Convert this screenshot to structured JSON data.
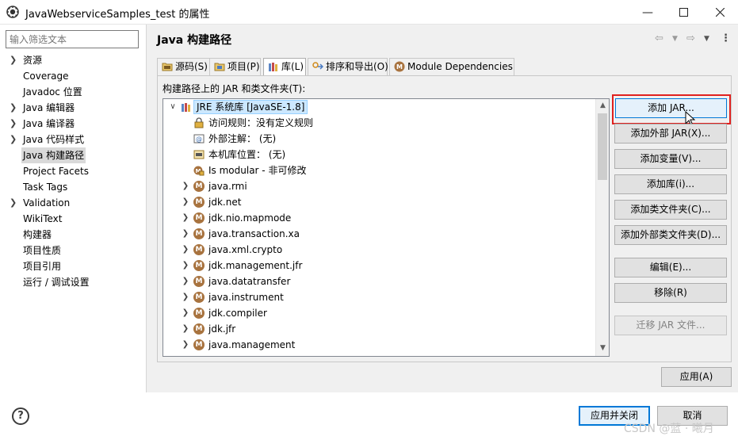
{
  "window": {
    "title": "JavaWebserviceSamples_test 的属性",
    "minimize_icon": "minimize-icon",
    "maximize_icon": "maximize-icon",
    "close_icon": "close-icon"
  },
  "filter": {
    "placeholder": "输入筛选文本"
  },
  "sidebar": {
    "items": [
      {
        "label": "资源",
        "expandable": true
      },
      {
        "label": "Coverage",
        "expandable": false
      },
      {
        "label": "Javadoc 位置",
        "expandable": false
      },
      {
        "label": "Java 编辑器",
        "expandable": true
      },
      {
        "label": "Java 编译器",
        "expandable": true
      },
      {
        "label": "Java 代码样式",
        "expandable": true
      },
      {
        "label": "Java 构建路径",
        "expandable": false,
        "selected": true
      },
      {
        "label": "Project Facets",
        "expandable": false
      },
      {
        "label": "Task Tags",
        "expandable": false
      },
      {
        "label": "Validation",
        "expandable": true
      },
      {
        "label": "WikiText",
        "expandable": false
      },
      {
        "label": "构建器",
        "expandable": false
      },
      {
        "label": "项目性质",
        "expandable": false
      },
      {
        "label": "项目引用",
        "expandable": false
      },
      {
        "label": "运行 / 调试设置",
        "expandable": false
      }
    ]
  },
  "page": {
    "title": "Java 构建路径",
    "tabs": [
      {
        "label": "源码(S)",
        "icon": "source-folder-icon"
      },
      {
        "label": "项目(P)",
        "icon": "project-icon"
      },
      {
        "label": "库(L)",
        "icon": "library-icon",
        "active": true
      },
      {
        "label": "排序和导出(O)",
        "icon": "order-export-icon"
      },
      {
        "label": "Module Dependencies",
        "icon": "module-icon"
      }
    ],
    "section_label": "构建路径上的 JAR 和类文件夹(T):"
  },
  "tree": {
    "root": "JRE 系统库 [JavaSE-1.8]",
    "children": [
      {
        "label": "访问规则：没有定义规则",
        "icon": "access-rules-icon"
      },
      {
        "label": "外部注解：  (无)",
        "icon": "annotation-icon"
      },
      {
        "label": "本机库位置：  (无)",
        "icon": "native-library-icon"
      },
      {
        "label": "Is modular  -  非可修改",
        "icon": "modular-icon"
      }
    ],
    "modules": [
      "java.rmi",
      "jdk.net",
      "jdk.nio.mapmode",
      "java.transaction.xa",
      "java.xml.crypto",
      "jdk.management.jfr",
      "java.datatransfer",
      "java.instrument",
      "jdk.compiler",
      "jdk.jfr",
      "java.management"
    ]
  },
  "buttons": {
    "add_jar": "添加 JAR...",
    "add_external_jar": "添加外部 JAR(X)...",
    "add_variable": "添加变量(V)...",
    "add_library": "添加库(i)...",
    "add_class_folder": "添加类文件夹(C)...",
    "add_external_class_folder": "添加外部类文件夹(D)...",
    "edit": "编辑(E)...",
    "remove": "移除(R)",
    "migrate_jar": "迁移 JAR 文件...",
    "apply": "应用(A)",
    "apply_and_close": "应用并关闭",
    "cancel": "取消"
  },
  "help": {
    "label": "?"
  },
  "watermark": "CSDN @蓝 · 曦月",
  "colors": {
    "highlight": "#e0211f",
    "selection": "#cce8ff",
    "module_icon": "#a8733f"
  }
}
